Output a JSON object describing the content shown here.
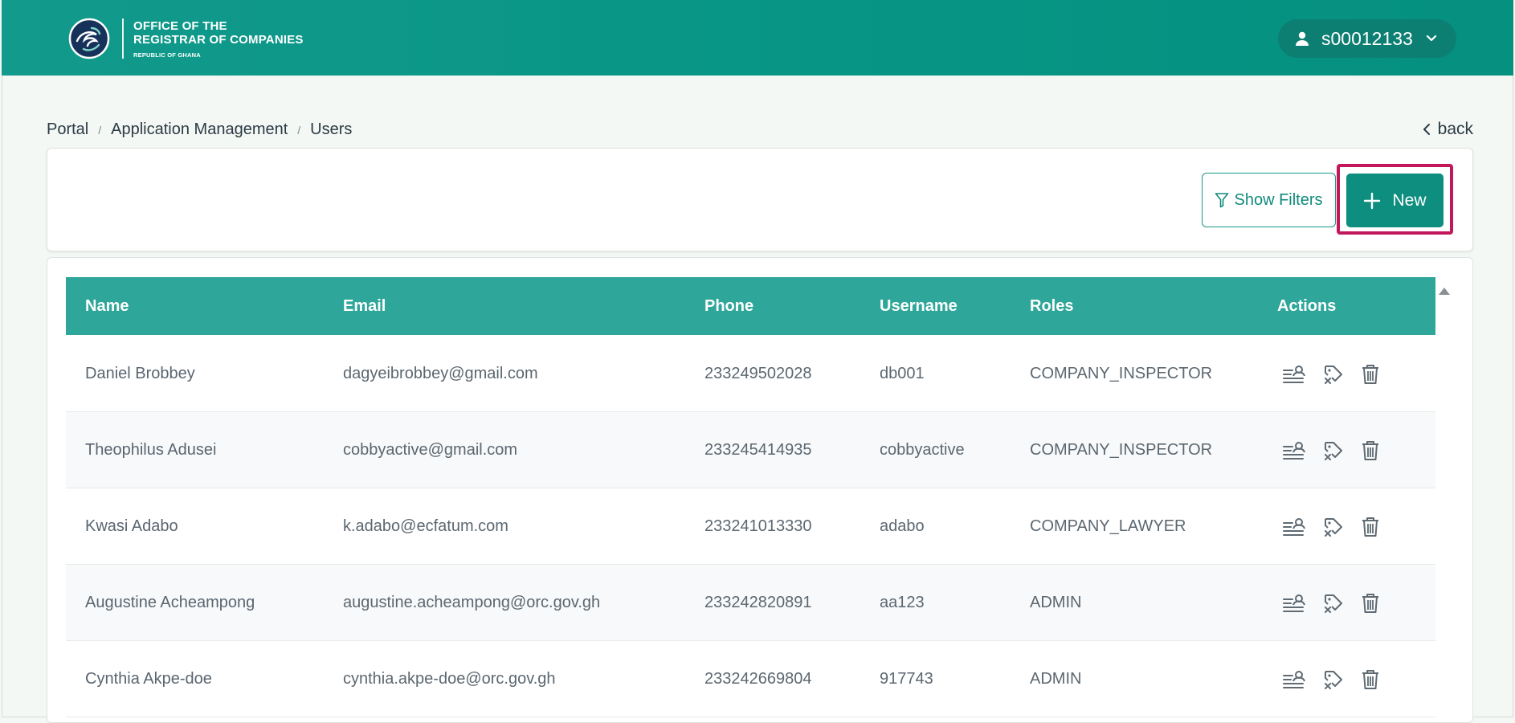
{
  "header": {
    "logo": {
      "line1": "OFFICE OF THE",
      "line2": "REGISTRAR OF COMPANIES",
      "sub": "REPUBLIC OF GHANA"
    },
    "user": {
      "username": "s00012133",
      "icon": "user-icon"
    }
  },
  "breadcrumb": {
    "items": [
      "Portal",
      "Application Management",
      "Users"
    ],
    "separator": "/"
  },
  "back": {
    "label": "back"
  },
  "toolbar": {
    "filters_label": "Show Filters",
    "new_label": "New"
  },
  "table": {
    "columns": [
      "Name",
      "Email",
      "Phone",
      "Username",
      "Roles",
      "Actions"
    ],
    "rows": [
      {
        "name": "Daniel Brobbey",
        "email": "dagyeibrobbey@gmail.com",
        "phone": "233249502028",
        "username": "db001",
        "roles": "COMPANY_INSPECTOR"
      },
      {
        "name": "Theophilus Adusei",
        "email": "cobbyactive@gmail.com",
        "phone": "233245414935",
        "username": "cobbyactive",
        "roles": "COMPANY_INSPECTOR"
      },
      {
        "name": "Kwasi Adabo",
        "email": "k.adabo@ecfatum.com",
        "phone": "233241013330",
        "username": "adabo",
        "roles": "COMPANY_LAWYER"
      },
      {
        "name": "Augustine Acheampong",
        "email": "augustine.acheampong@orc.gov.gh",
        "phone": "233242820891",
        "username": "aa123",
        "roles": "ADMIN"
      },
      {
        "name": "Cynthia Akpe-doe",
        "email": "cynthia.akpe-doe@orc.gov.gh",
        "phone": "233242669804",
        "username": "917743",
        "roles": "ADMIN"
      }
    ],
    "row_actions": [
      "user-profile-icon",
      "tag-remove-icon",
      "trash-icon"
    ]
  },
  "colors": {
    "header_bg": "#079585",
    "table_head_bg": "#2ea699",
    "primary": "#0d8e7f",
    "highlight": "#c2185b"
  }
}
